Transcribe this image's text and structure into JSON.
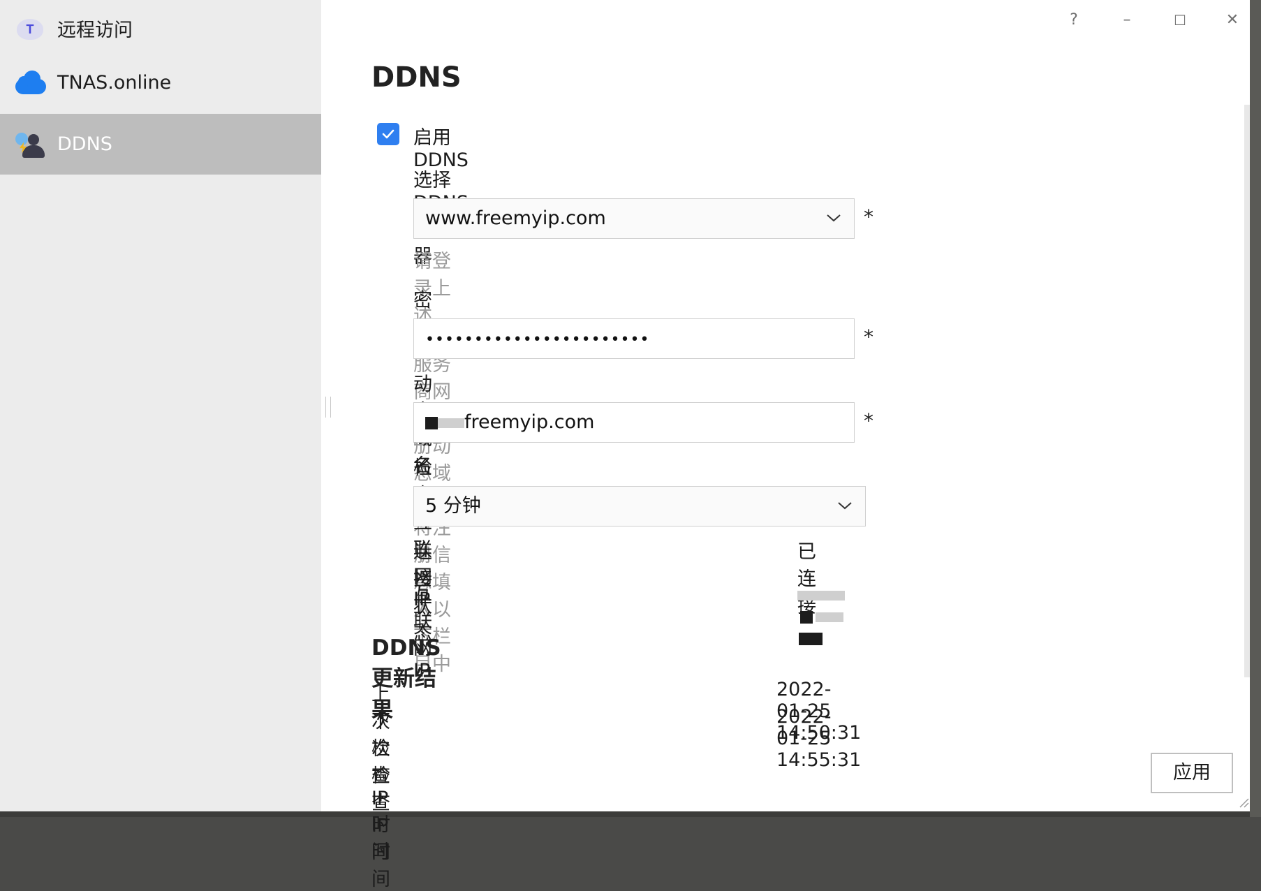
{
  "window": {
    "controls": {
      "help": "?",
      "minimize": "–",
      "maximize": "☐",
      "close": "✕"
    }
  },
  "sidebar": {
    "items": [
      {
        "label": "远程访问",
        "icon": "tnas-logo-icon",
        "active": false
      },
      {
        "label": "TNAS.online",
        "icon": "cloud-icon",
        "active": false
      },
      {
        "label": "DDNS",
        "icon": "ddns-icon",
        "active": true
      }
    ]
  },
  "main": {
    "title": "DDNS",
    "enable_label": "启用DDNS",
    "enabled": true,
    "server": {
      "label": "选择 DDNS 服务器",
      "value": "www.freemyip.com",
      "required_mark": "*"
    },
    "hint": "请登录上述DDNS服务商网站注册动态域名,并将注册信息填入以下栏目中",
    "password": {
      "label": "密码",
      "value": "•••••••••••••••••••••••",
      "required_mark": "*"
    },
    "domain": {
      "label": "动态域名",
      "value_suffix": "freemyip.com",
      "required_mark": "*"
    },
    "check_ip": {
      "label": "检查互联网IP",
      "value": "5 分钟"
    },
    "status": {
      "label": "连接状态",
      "value": "已连接"
    },
    "internet_ip": {
      "label": "互联网IP"
    },
    "result": {
      "title": "DDNS 更新结果",
      "last_check_label": "上次检查IP时间",
      "last_check_value": "2022-01-25 14:50:31",
      "next_check_label": "下次检查 IP 时间",
      "next_check_value": "2022-01-25 14:55:31"
    },
    "apply_label": "应用"
  },
  "colors": {
    "accent": "#2f7ff0",
    "sidebar_bg": "#ececec",
    "sidebar_active": "#bdbdbd",
    "hint": "#9a9a9a"
  }
}
